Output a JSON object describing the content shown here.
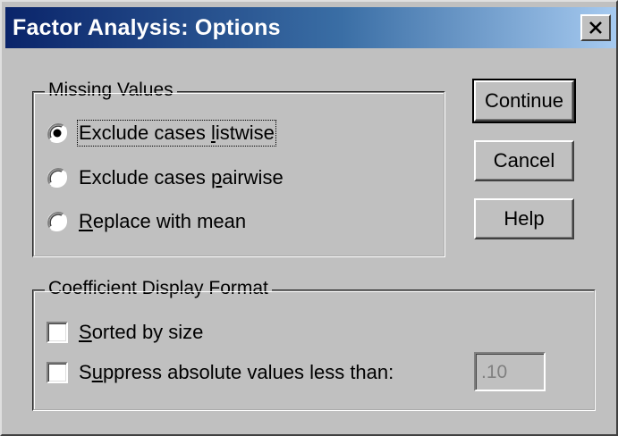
{
  "window": {
    "title": "Factor Analysis: Options",
    "close_glyph": "✕"
  },
  "missing_values": {
    "legend": "Missing Values",
    "options": [
      {
        "pre": "Exclude cases ",
        "u": "l",
        "post": "istwise",
        "selected": true
      },
      {
        "pre": "Exclude cases ",
        "u": "p",
        "post": "airwise",
        "selected": false
      },
      {
        "pre": "",
        "u": "R",
        "post": "eplace with mean",
        "selected": false
      }
    ]
  },
  "coefficient_display": {
    "legend": "Coefficient Display Format",
    "sorted": {
      "pre": "",
      "u": "S",
      "post": "orted by size",
      "checked": false
    },
    "suppress": {
      "pre": "S",
      "u": "u",
      "post": "ppress absolute values less than:",
      "checked": false
    },
    "threshold": ".10"
  },
  "buttons": {
    "continue": "Continue",
    "cancel": "Cancel",
    "help": "Help"
  },
  "icons": {
    "close": "close-icon",
    "radio": "radio-icon"
  },
  "colors": {
    "title_start": "#0a246a",
    "title_end": "#a6caf0",
    "face": "#c0c0c0"
  }
}
